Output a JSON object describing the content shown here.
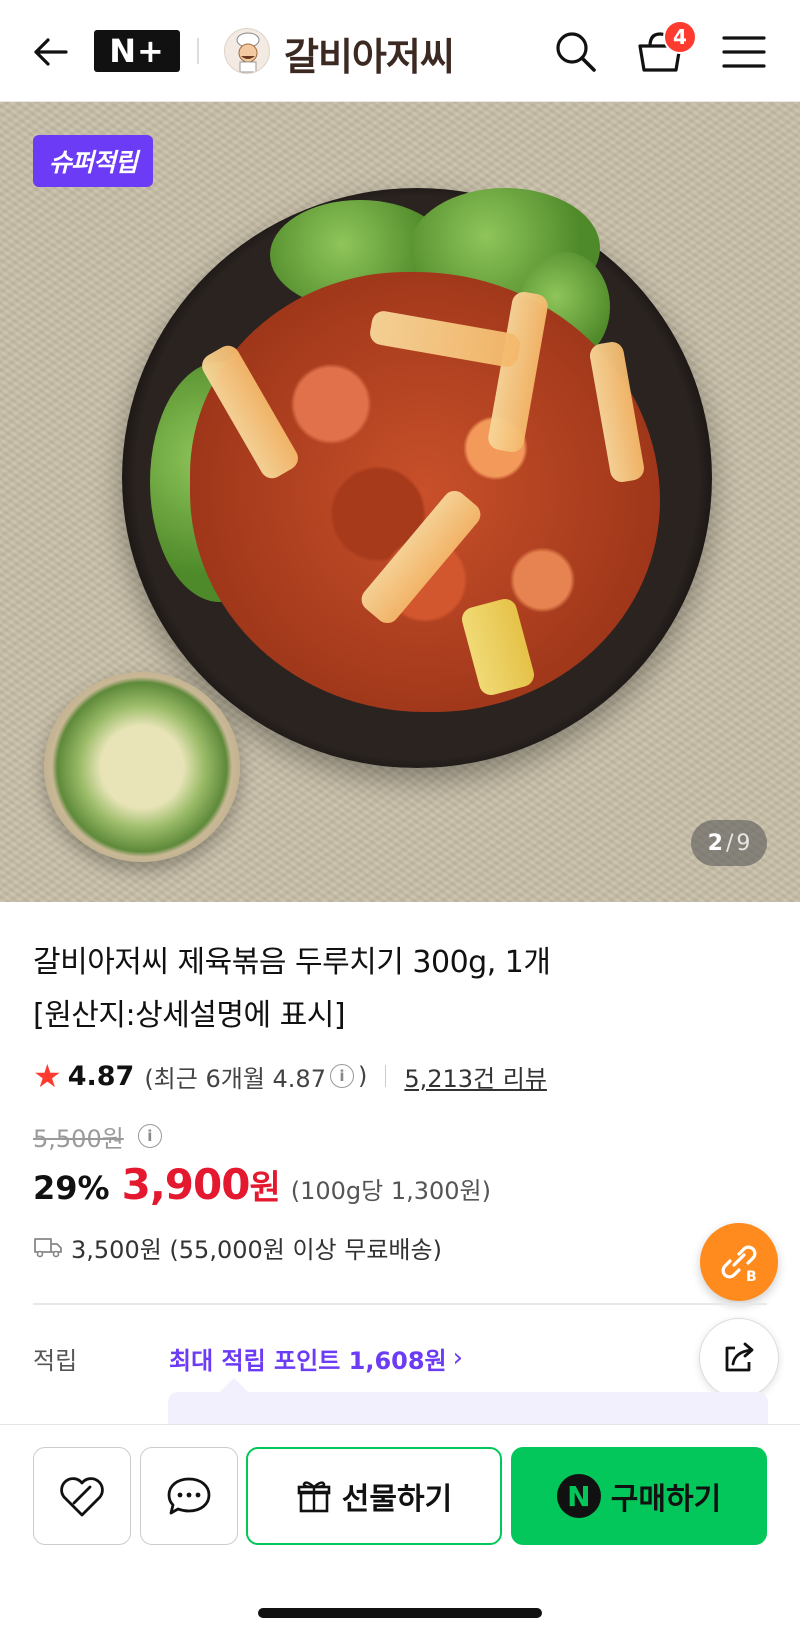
{
  "header": {
    "badge": "N+",
    "store_name": "갈비아저씨",
    "cart_count": "4"
  },
  "hero": {
    "badge": "슈퍼적립",
    "counter_current": "2",
    "counter_separator": "/",
    "counter_total": "9"
  },
  "product": {
    "title_line1": "갈비아저씨 제육볶음 두루치기 300g, 1개",
    "title_line2": "[원산지:상세설명에 표시]",
    "rating": "4.87",
    "recent_rating_prefix": "(최근 6개월 4.87",
    "recent_rating_suffix": ")",
    "review_count": "5,213건 리뷰",
    "original_price": "5,500원",
    "discount": "29%",
    "sale_price": "3,900",
    "won": "원",
    "unit_price": "(100g당 1,300원)",
    "shipping": "3,500원 (55,000원 이상 무료배송)"
  },
  "points": {
    "label": "적립",
    "value": "최대 적립 포인트 1,608원"
  },
  "bottom_bar": {
    "gift_label": "선물하기",
    "buy_label": "구매하기",
    "n_logo": "N"
  },
  "colors": {
    "brand_green": "#03c75a",
    "sale_red": "#e4182e",
    "points_purple": "#6c3bf5",
    "fab_orange": "#ff8a1d"
  },
  "icons": [
    "back-arrow-icon",
    "search-icon",
    "cart-icon",
    "menu-icon",
    "info-icon",
    "truck-icon",
    "link-b-icon",
    "share-icon",
    "heart-icon",
    "chat-icon",
    "gift-icon",
    "naver-n-icon",
    "star-icon"
  ]
}
